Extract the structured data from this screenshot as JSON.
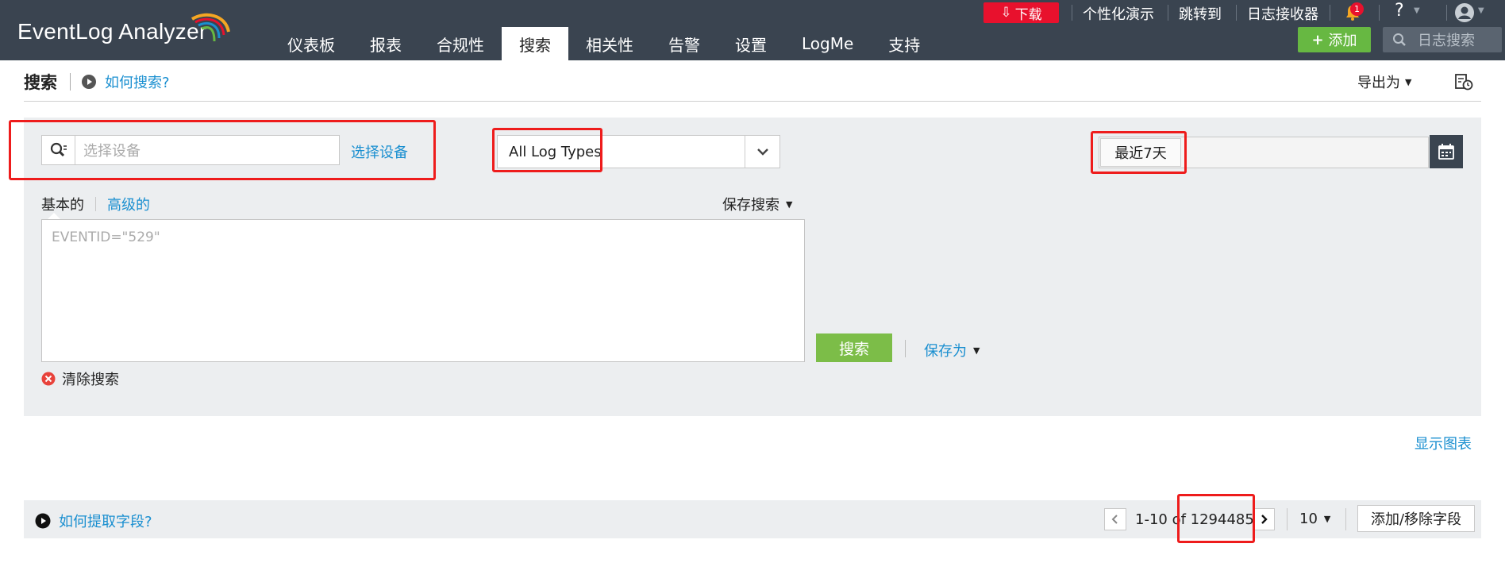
{
  "app": {
    "logo_text": "EventLog Analyzer"
  },
  "utility_bar": {
    "download_label": "下载",
    "links": [
      "个性化演示",
      "跳转到",
      "日志接收器"
    ],
    "notification_count": "1",
    "help_label": "?"
  },
  "nav": {
    "items": [
      {
        "label": "仪表板"
      },
      {
        "label": "报表"
      },
      {
        "label": "合规性"
      },
      {
        "label": "搜索",
        "active": true
      },
      {
        "label": "相关性"
      },
      {
        "label": "告警"
      },
      {
        "label": "设置"
      },
      {
        "label": "LogMe"
      },
      {
        "label": "支持"
      }
    ],
    "add_label": "添加",
    "log_search_placeholder": "日志搜索"
  },
  "subheader": {
    "title": "搜索",
    "how_to_search": "如何搜索?",
    "export_label": "导出为"
  },
  "search_panel": {
    "device_placeholder": "选择设备",
    "select_device_link": "选择设备",
    "log_type_value": "All Log Types",
    "date_range_value": "最近7天",
    "mode_tabs": {
      "basic": "基本的",
      "advanced": "高级的"
    },
    "saved_search_label": "保存搜索",
    "query_placeholder": "EVENTID=\"529\"",
    "search_button": "搜索",
    "save_as_label": "保存为",
    "clear_search_label": "清除搜索"
  },
  "show_chart_link": "显示图表",
  "results": {
    "extract_fields_link": "如何提取字段?",
    "range_text": "1-10 of 1294485",
    "per_page": "10",
    "add_remove_fields": "添加/移除字段"
  },
  "colors": {
    "header_bg": "#3a4450",
    "accent_link": "#1a8fd0",
    "download_red": "#e8112d",
    "add_green": "#67b842",
    "search_green": "#7cbd48",
    "highlight_red": "#ee1c1c"
  }
}
